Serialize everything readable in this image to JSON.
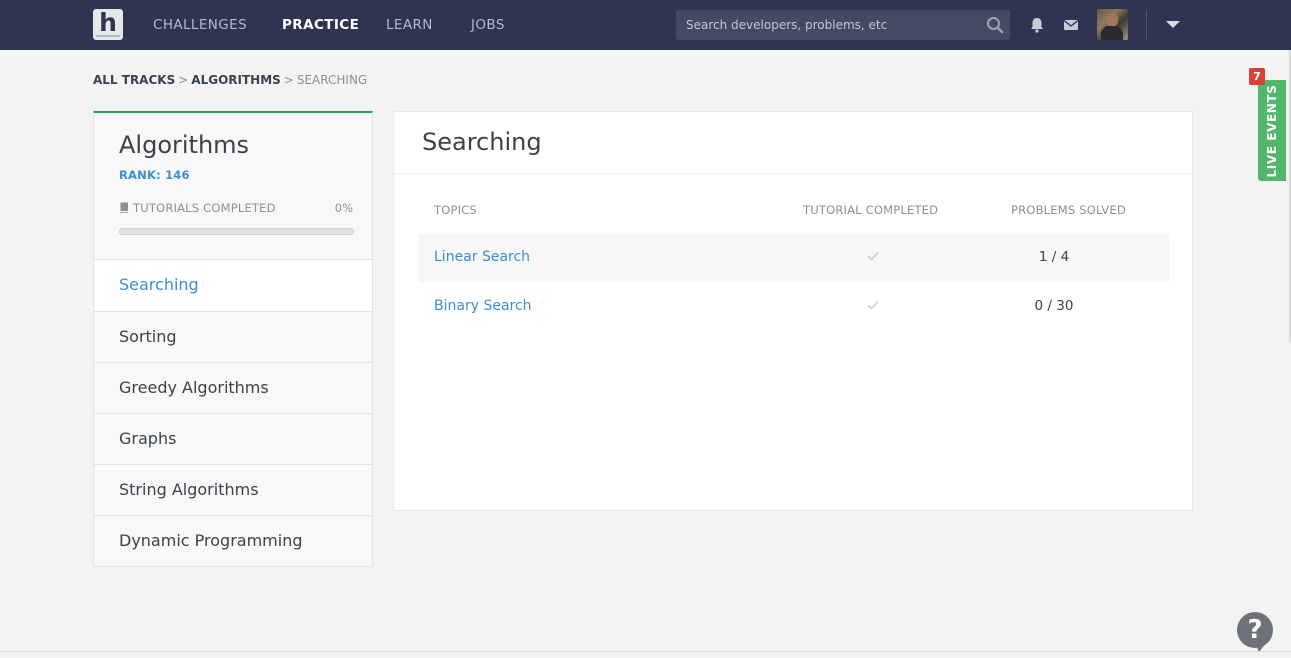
{
  "nav": {
    "logo": "h",
    "items": [
      "CHALLENGES",
      "PRACTICE",
      "LEARN",
      "JOBS"
    ],
    "active": "PRACTICE",
    "search_placeholder": "Search developers, problems, etc",
    "icons": [
      "search-icon",
      "bell-icon",
      "mail-icon",
      "avatar",
      "chevron-down-icon"
    ]
  },
  "breadcrumb": {
    "all_tracks": "ALL TRACKS",
    "track": "ALGORITHMS",
    "current": "SEARCHING",
    "separator": ">"
  },
  "track": {
    "title": "Algorithms",
    "rank_text": "RANK: 146",
    "tutorials_label": "TUTORIALS COMPLETED",
    "tutorials_percent": "0%",
    "tutorials_progress": 0,
    "progress_color": "#1ba94c"
  },
  "categories": [
    "Searching",
    "Sorting",
    "Greedy Algorithms",
    "Graphs",
    "String Algorithms",
    "Dynamic Programming"
  ],
  "active_category": "Searching",
  "main": {
    "title": "Searching",
    "columns": [
      "TOPICS",
      "TUTORIAL COMPLETED",
      "PROBLEMS SOLVED"
    ],
    "rows": [
      {
        "topic": "Linear Search",
        "tutorial_completed": false,
        "solved": "1 / 4"
      },
      {
        "topic": "Binary Search",
        "tutorial_completed": false,
        "solved": "0 / 30"
      }
    ]
  },
  "live_events": {
    "label": "LIVE EVENTS",
    "badge": "7"
  },
  "help": {
    "label": "?"
  },
  "colors": {
    "navbar": "#2f3452",
    "accent_blue": "#3a8dd6",
    "accent_green": "#1ba94c",
    "live_green": "#52b76b",
    "badge_red": "#d9403a"
  }
}
